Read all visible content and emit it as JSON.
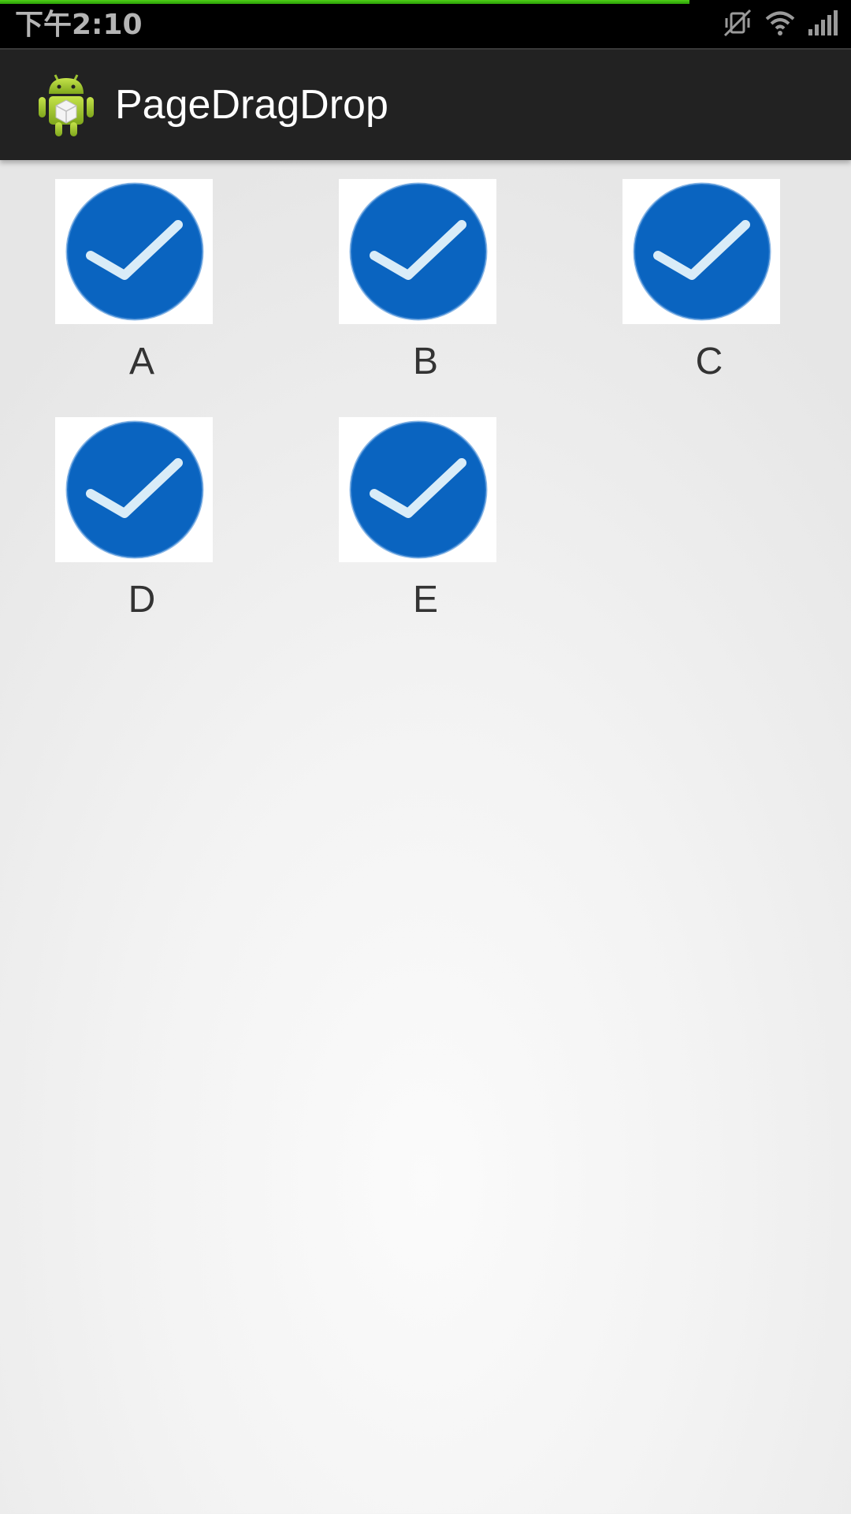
{
  "status_bar": {
    "time": "下午2:10",
    "icons": [
      "vibrate-muted-icon",
      "wifi-icon",
      "signal-icon"
    ],
    "progress": 0.81,
    "progress_color": "#3cba0e"
  },
  "action_bar": {
    "app_icon": "android-app-icon",
    "title": "PageDragDrop",
    "background": "#222222"
  },
  "grid": {
    "items": [
      {
        "label": "A",
        "icon": "check-circle-icon"
      },
      {
        "label": "B",
        "icon": "check-circle-icon"
      },
      {
        "label": "C",
        "icon": "check-circle-icon"
      },
      {
        "label": "D",
        "icon": "check-circle-icon"
      },
      {
        "label": "E",
        "icon": "check-circle-icon"
      }
    ],
    "icon_color": "#0a64c0"
  }
}
